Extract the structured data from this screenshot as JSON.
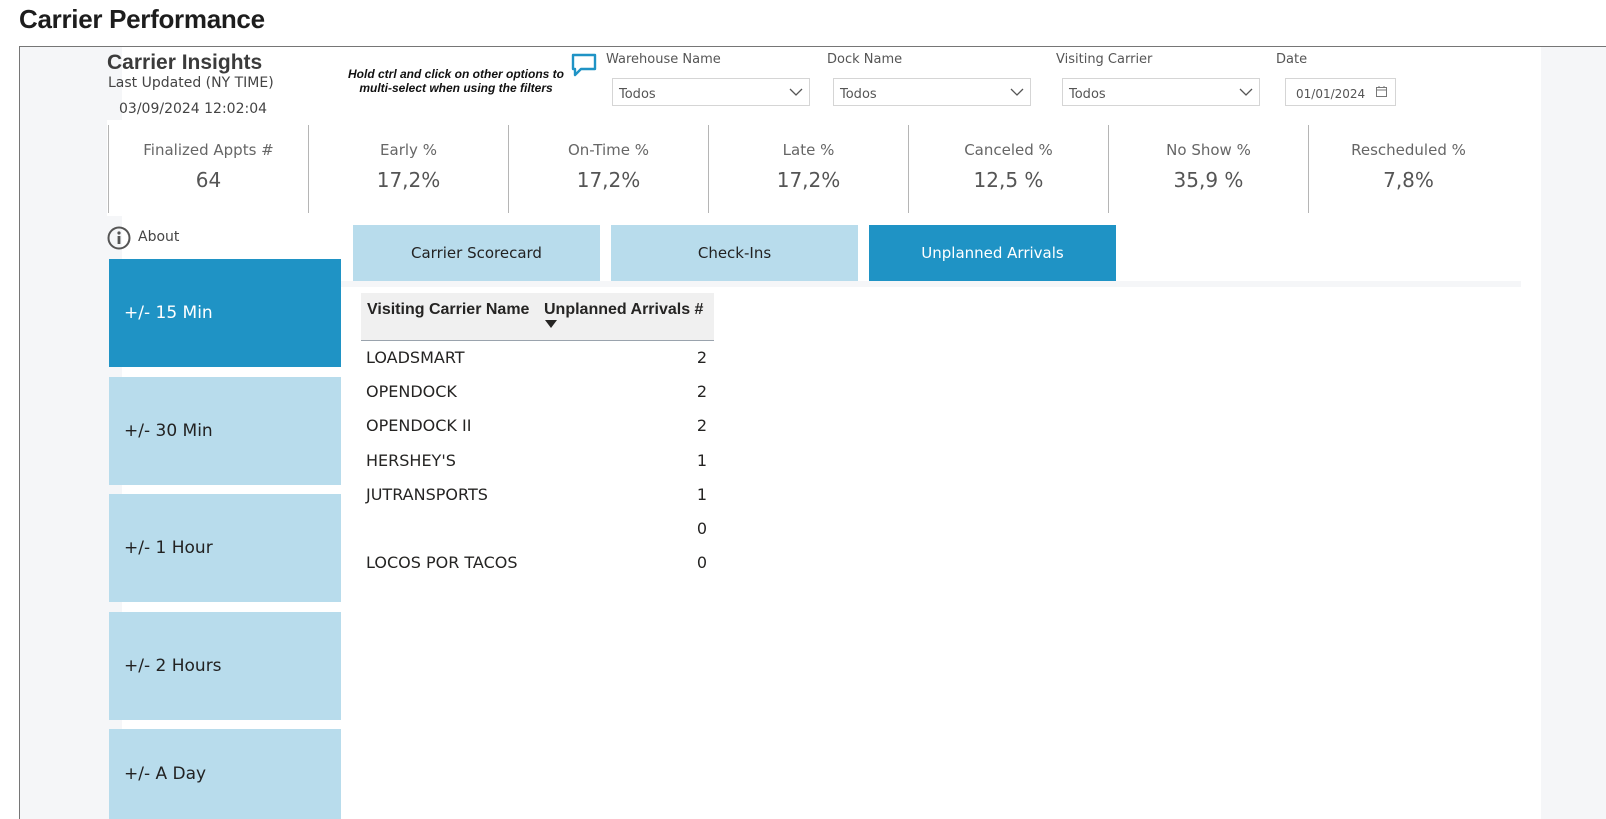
{
  "page": {
    "title": "Carrier Performance"
  },
  "header": {
    "title": "Carrier Insights",
    "subtitle": "Last Updated (NY TIME)",
    "timestamp": "03/09/2024 12:02:04",
    "hint": "Hold ctrl and click on other options to multi-select when using the filters",
    "hint_icon": "comment-icon"
  },
  "filters": [
    {
      "label": "Warehouse Name",
      "value": "Todos"
    },
    {
      "label": "Dock Name",
      "value": "Todos"
    },
    {
      "label": "Visiting Carrier",
      "value": "Todos"
    },
    {
      "label": "Date",
      "value": "01/01/2024"
    }
  ],
  "kpis": [
    {
      "label": "Finalized Appts #",
      "value": "64"
    },
    {
      "label": "Early %",
      "value": "17,2%"
    },
    {
      "label": "On-Time %",
      "value": "17,2%"
    },
    {
      "label": "Late %",
      "value": "17,2%"
    },
    {
      "label": "Canceled %",
      "value": "12,5 %"
    },
    {
      "label": "No Show %",
      "value": "35,9 %"
    },
    {
      "label": "Rescheduled %",
      "value": "7,8%"
    }
  ],
  "about": {
    "label": "About",
    "icon": "info-icon"
  },
  "ranges": [
    {
      "label": "+/- 15 Min",
      "active": true
    },
    {
      "label": "+/- 30 Min",
      "active": false
    },
    {
      "label": "+/- 1 Hour",
      "active": false
    },
    {
      "label": "+/- 2 Hours",
      "active": false
    },
    {
      "label": "+/- A Day",
      "active": false
    }
  ],
  "tabs": [
    {
      "label": "Carrier Scorecard",
      "active": false
    },
    {
      "label": "Check-Ins",
      "active": false
    },
    {
      "label": "Unplanned Arrivals",
      "active": true
    }
  ],
  "table": {
    "columns": [
      "Visiting Carrier Name",
      "Unplanned Arrivals #"
    ],
    "sort_icon": "sort-descending-icon",
    "rows": [
      {
        "name": "LOADSMART",
        "value": "2"
      },
      {
        "name": "OPENDOCK",
        "value": "2"
      },
      {
        "name": "OPENDOCK II",
        "value": "2"
      },
      {
        "name": "HERSHEY'S",
        "value": "1"
      },
      {
        "name": "JUTRANSPORTS",
        "value": "1"
      },
      {
        "name": "",
        "value": "0"
      },
      {
        "name": "LOCOS POR TACOS",
        "value": "0"
      }
    ]
  },
  "colors": {
    "accent": "#1f93c5",
    "accent_light": "#b8dcec"
  }
}
